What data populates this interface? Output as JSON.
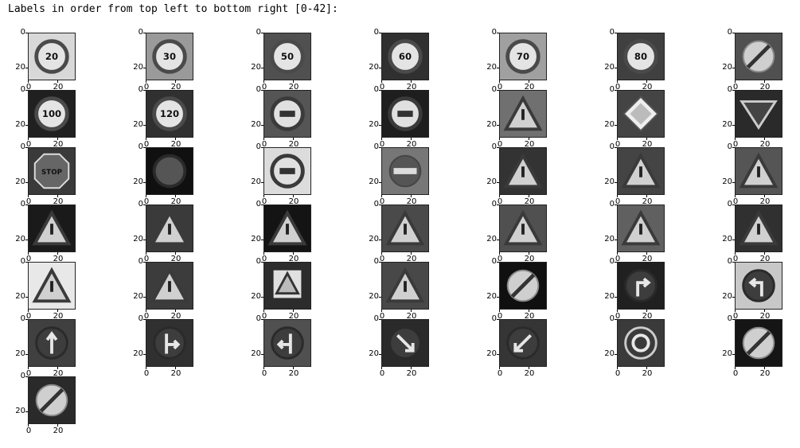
{
  "header": {
    "text": "Labels in order from top left to bottom right [0-42]:"
  },
  "axes": {
    "y_ticks": [
      "0",
      "20"
    ],
    "x_ticks": [
      "0",
      "20"
    ]
  },
  "signs": [
    {
      "icon": "speed-limit-20-icon",
      "text": "20",
      "shape": "circle-red",
      "bg": "#d8d8d8"
    },
    {
      "icon": "speed-limit-30-icon",
      "text": "30",
      "shape": "circle-red",
      "bg": "#9a9a9a"
    },
    {
      "icon": "speed-limit-50-icon",
      "text": "50",
      "shape": "circle-red",
      "bg": "#505050"
    },
    {
      "icon": "speed-limit-60-icon",
      "text": "60",
      "shape": "circle-red",
      "bg": "#303030"
    },
    {
      "icon": "speed-limit-70-icon",
      "text": "70",
      "shape": "circle-red",
      "bg": "#a0a0a0"
    },
    {
      "icon": "speed-limit-80-icon",
      "text": "80",
      "shape": "circle-red",
      "bg": "#404040"
    },
    {
      "icon": "end-speed-limit-80-icon",
      "text": "",
      "shape": "end-limit",
      "bg": "#505050"
    },
    {
      "icon": "speed-limit-100-icon",
      "text": "100",
      "shape": "circle-red",
      "bg": "#202020"
    },
    {
      "icon": "speed-limit-120-icon",
      "text": "120",
      "shape": "circle-red",
      "bg": "#303030"
    },
    {
      "icon": "no-passing-icon",
      "text": "",
      "shape": "no-passing",
      "bg": "#555555"
    },
    {
      "icon": "no-passing-trucks-icon",
      "text": "",
      "shape": "no-passing",
      "bg": "#1e1e1e"
    },
    {
      "icon": "right-of-way-icon",
      "text": "",
      "shape": "triangle",
      "bg": "#707070"
    },
    {
      "icon": "priority-road-icon",
      "text": "",
      "shape": "diamond",
      "bg": "#444444"
    },
    {
      "icon": "yield-icon",
      "text": "",
      "shape": "inverted-triangle",
      "bg": "#2a2a2a"
    },
    {
      "icon": "stop-icon",
      "text": "STOP",
      "shape": "octagon",
      "bg": "#3a3a3a"
    },
    {
      "icon": "no-vehicles-icon",
      "text": "",
      "shape": "circle-plain",
      "bg": "#101010"
    },
    {
      "icon": "no-trucks-icon",
      "text": "",
      "shape": "no-passing",
      "bg": "#dcdcdc"
    },
    {
      "icon": "no-entry-icon",
      "text": "",
      "shape": "no-entry",
      "bg": "#777777"
    },
    {
      "icon": "general-caution-icon",
      "text": "",
      "shape": "triangle",
      "bg": "#333333"
    },
    {
      "icon": "dangerous-curve-left-icon",
      "text": "",
      "shape": "triangle",
      "bg": "#444444"
    },
    {
      "icon": "dangerous-curve-right-icon",
      "text": "",
      "shape": "triangle",
      "bg": "#555555"
    },
    {
      "icon": "double-curve-icon",
      "text": "",
      "shape": "triangle",
      "bg": "#1a1a1a"
    },
    {
      "icon": "bumpy-road-icon",
      "text": "",
      "shape": "triangle",
      "bg": "#3a3a3a"
    },
    {
      "icon": "slippery-road-icon",
      "text": "",
      "shape": "triangle",
      "bg": "#141414"
    },
    {
      "icon": "road-narrows-icon",
      "text": "",
      "shape": "triangle",
      "bg": "#4a4a4a"
    },
    {
      "icon": "road-work-icon",
      "text": "",
      "shape": "triangle",
      "bg": "#505050"
    },
    {
      "icon": "traffic-signals-icon",
      "text": "",
      "shape": "triangle",
      "bg": "#606060"
    },
    {
      "icon": "pedestrians-icon",
      "text": "",
      "shape": "triangle",
      "bg": "#303030"
    },
    {
      "icon": "children-crossing-icon",
      "text": "",
      "shape": "triangle",
      "bg": "#e8e8e8"
    },
    {
      "icon": "bicycles-crossing-icon",
      "text": "",
      "shape": "triangle",
      "bg": "#3c3c3c"
    },
    {
      "icon": "ice-snow-icon",
      "text": "",
      "shape": "square-triangle",
      "bg": "#2c2c2c"
    },
    {
      "icon": "wild-animals-icon",
      "text": "",
      "shape": "triangle",
      "bg": "#484848"
    },
    {
      "icon": "end-all-limits-icon",
      "text": "",
      "shape": "end-limit",
      "bg": "#101010"
    },
    {
      "icon": "turn-right-ahead-icon",
      "text": "",
      "shape": "arrow-turn-right",
      "bg": "#202020"
    },
    {
      "icon": "turn-left-ahead-icon",
      "text": "",
      "shape": "arrow-turn-left",
      "bg": "#c8c8c8"
    },
    {
      "icon": "ahead-only-icon",
      "text": "",
      "shape": "arrow-up",
      "bg": "#404040"
    },
    {
      "icon": "go-straight-or-right-icon",
      "text": "",
      "shape": "arrow-straight-right",
      "bg": "#303030"
    },
    {
      "icon": "go-straight-or-left-icon",
      "text": "",
      "shape": "arrow-straight-left",
      "bg": "#505050"
    },
    {
      "icon": "keep-right-icon",
      "text": "",
      "shape": "arrow-down-right",
      "bg": "#2a2a2a"
    },
    {
      "icon": "keep-left-icon",
      "text": "",
      "shape": "arrow-down-left",
      "bg": "#353535"
    },
    {
      "icon": "roundabout-icon",
      "text": "",
      "shape": "roundabout",
      "bg": "#3a3a3a"
    },
    {
      "icon": "end-no-passing-icon",
      "text": "",
      "shape": "end-limit",
      "bg": "#151515"
    },
    {
      "icon": "end-no-passing-trucks-icon",
      "text": "",
      "shape": "end-limit",
      "bg": "#2a2a2a"
    }
  ]
}
